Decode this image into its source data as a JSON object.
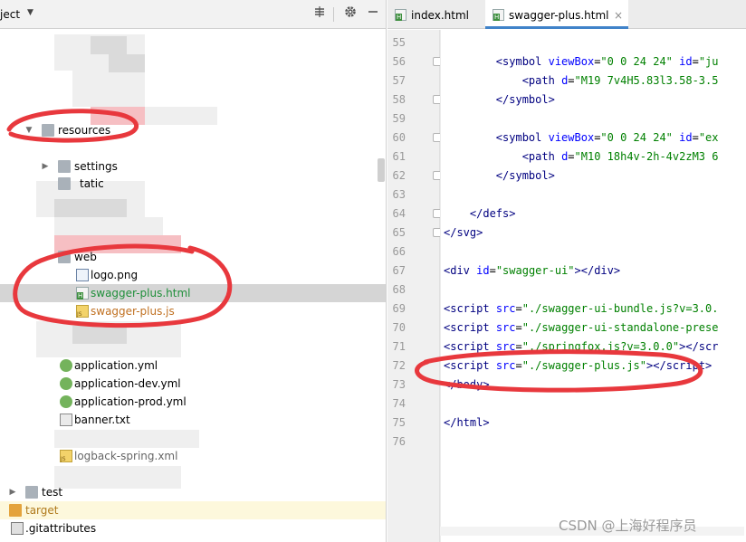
{
  "project_panel": {
    "title": "ject",
    "tree": [
      {
        "label": "resources",
        "kind": "folder"
      },
      {
        "label": "settings",
        "kind": "folder"
      },
      {
        "label": "tatic",
        "kind": "folder"
      },
      {
        "label": "web",
        "kind": "folder"
      },
      {
        "label": "logo.png",
        "kind": "image"
      },
      {
        "label": "swagger-plus.html",
        "kind": "html",
        "selected": true
      },
      {
        "label": "swagger-plus.js",
        "kind": "js"
      },
      {
        "label": "application.yml",
        "kind": "yml"
      },
      {
        "label": "application-dev.yml",
        "kind": "yml"
      },
      {
        "label": "application-prod.yml",
        "kind": "yml"
      },
      {
        "label": "banner.txt",
        "kind": "txt"
      },
      {
        "label": "logback-spring.xml",
        "kind": "xml"
      },
      {
        "label": "test",
        "kind": "folder"
      },
      {
        "label": "target",
        "kind": "folder-excluded"
      },
      {
        "label": ".gitattributes",
        "kind": "git"
      }
    ]
  },
  "editor": {
    "tabs": [
      {
        "label": "index.html",
        "active": false
      },
      {
        "label": "swagger-plus.html",
        "active": true
      }
    ],
    "close_glyph": "×",
    "lines": [
      {
        "num": "55",
        "html": ""
      },
      {
        "num": "56",
        "html": "        <span class=\"t\">&lt;symbol</span> <span class=\"a\">viewBox</span>=<span class=\"v\">\"0 0 24 24\"</span> <span class=\"a\">id</span>=<span class=\"v\">\"ju</span>"
      },
      {
        "num": "57",
        "html": "            <span class=\"t\">&lt;path</span> <span class=\"a\">d</span>=<span class=\"v\">\"M19 7v4H5.83l3.58-3.5</span>"
      },
      {
        "num": "58",
        "html": "        <span class=\"t\">&lt;/symbol&gt;</span>"
      },
      {
        "num": "59",
        "html": ""
      },
      {
        "num": "60",
        "html": "        <span class=\"t\">&lt;symbol</span> <span class=\"a\">viewBox</span>=<span class=\"v\">\"0 0 24 24\"</span> <span class=\"a\">id</span>=<span class=\"v\">\"ex</span>"
      },
      {
        "num": "61",
        "html": "            <span class=\"t\">&lt;path</span> <span class=\"a\">d</span>=<span class=\"v\">\"M10 18h4v-2h-4v2zM3 6</span>"
      },
      {
        "num": "62",
        "html": "        <span class=\"t\">&lt;/symbol&gt;</span>"
      },
      {
        "num": "63",
        "html": ""
      },
      {
        "num": "64",
        "html": "    <span class=\"t\">&lt;/defs&gt;</span>"
      },
      {
        "num": "65",
        "html": "<span class=\"t\">&lt;/svg&gt;</span>"
      },
      {
        "num": "66",
        "html": ""
      },
      {
        "num": "67",
        "html": "<span class=\"t\">&lt;div</span> <span class=\"a\">id</span>=<span class=\"v\">\"swagger-ui\"</span><span class=\"t\">&gt;&lt;/div&gt;</span>"
      },
      {
        "num": "68",
        "html": ""
      },
      {
        "num": "69",
        "html": "<span class=\"t\">&lt;script</span> <span class=\"a\">src</span>=<span class=\"v\">\"./swagger-ui-bundle.js?v=3.0.</span>"
      },
      {
        "num": "70",
        "html": "<span class=\"t\">&lt;script</span> <span class=\"a\">src</span>=<span class=\"v\">\"./swagger-ui-standalone-prese</span>"
      },
      {
        "num": "71",
        "html": "<span class=\"t\">&lt;script</span> <span class=\"a\">src</span>=<span class=\"v\">\"./springfox.js?v=3.0.0\"</span><span class=\"t\">&gt;&lt;/scr</span>"
      },
      {
        "num": "72",
        "html": "<span class=\"t\">&lt;script</span> <span class=\"a\">src</span>=<span class=\"v\">\"./swagger-plus.js\"</span><span class=\"t\">&gt;&lt;/script&gt;</span>"
      },
      {
        "num": "73",
        "html": "<span class=\"t\">&lt;/body&gt;</span>"
      },
      {
        "num": "74",
        "html": ""
      },
      {
        "num": "75",
        "html": "<span class=\"t\">&lt;/html&gt;</span>"
      },
      {
        "num": "76",
        "html": ""
      }
    ]
  },
  "watermark": "CSDN @上海好程序员",
  "colors": {
    "annotation": "#e8383d",
    "selection": "#d5d5d5",
    "active_tab_underline": "#4083c9"
  }
}
